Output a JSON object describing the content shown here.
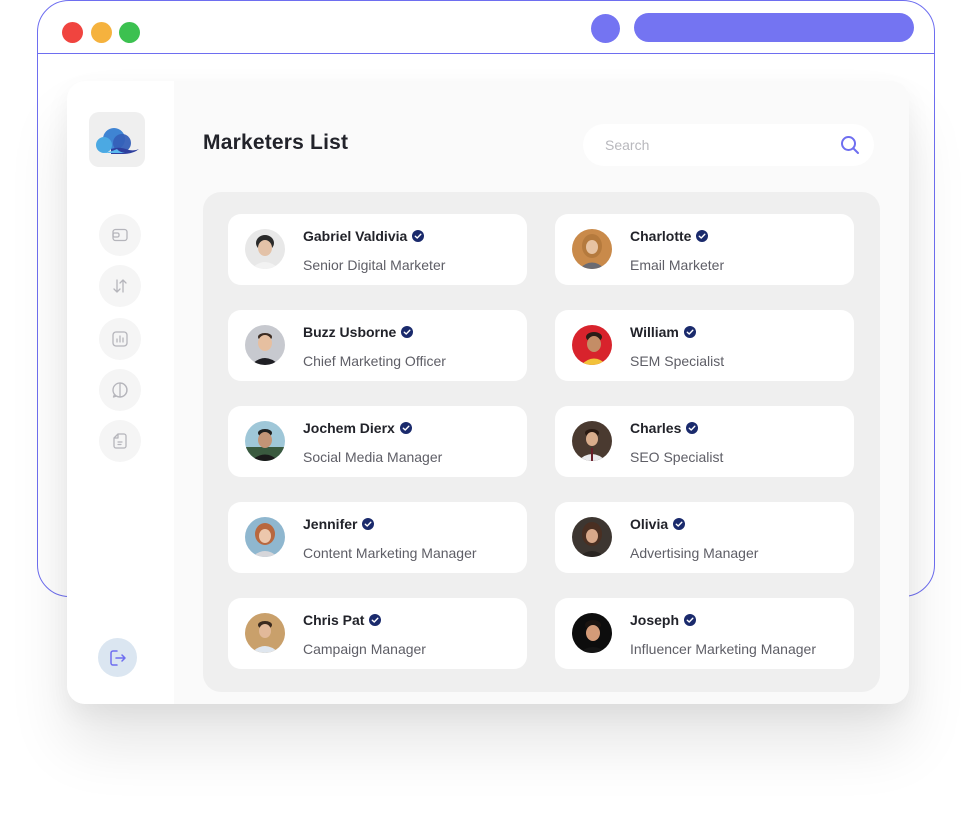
{
  "page": {
    "title": "Marketers List"
  },
  "search": {
    "placeholder": "Search",
    "value": ""
  },
  "sidebar": {
    "logo": "cloud-logo",
    "items": [
      {
        "icon": "wallet-icon"
      },
      {
        "icon": "transfer-arrows-icon"
      },
      {
        "icon": "chart-icon"
      },
      {
        "icon": "chat-icon"
      },
      {
        "icon": "document-icon"
      }
    ],
    "logout_icon": "logout-icon"
  },
  "colors": {
    "accent": "#7474f2",
    "verified": "#1a2a6c"
  },
  "marketers": [
    {
      "name": "Gabriel Valdivia",
      "role": "Senior Digital Marketer",
      "verified": true
    },
    {
      "name": "Charlotte",
      "role": "Email Marketer",
      "verified": true
    },
    {
      "name": "Buzz Usborne",
      "role": "Chief Marketing Officer",
      "verified": true
    },
    {
      "name": "William",
      "role": "SEM Specialist",
      "verified": true
    },
    {
      "name": "Jochem Dierx",
      "role": "Social Media Manager",
      "verified": true
    },
    {
      "name": "Charles",
      "role": "SEO Specialist",
      "verified": true
    },
    {
      "name": "Jennifer",
      "role": "Content Marketing Manager",
      "verified": true
    },
    {
      "name": "Olivia",
      "role": "Advertising Manager",
      "verified": true
    },
    {
      "name": "Chris Pat",
      "role": "Campaign Manager",
      "verified": true
    },
    {
      "name": "Joseph",
      "role": "Influencer Marketing Manager",
      "verified": true
    }
  ]
}
